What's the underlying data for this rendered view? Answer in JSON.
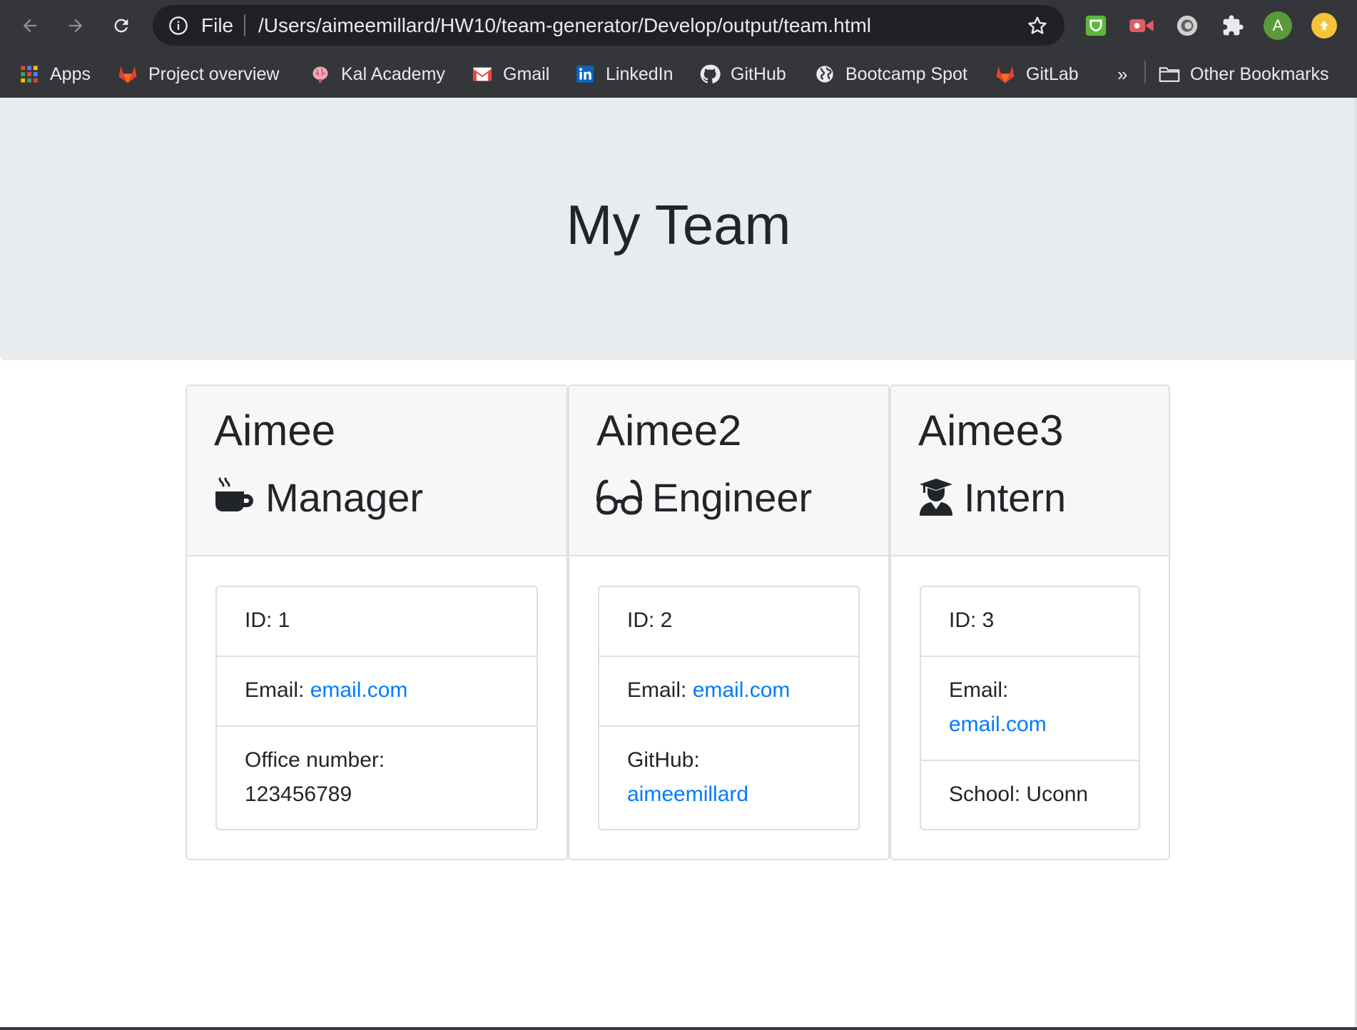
{
  "browser": {
    "scheme_label": "File",
    "url": "/Users/aimeemillard/HW10/team-generator/Develop/output/team.html",
    "avatar_letter": "A",
    "bookmarks": [
      {
        "label": "Apps",
        "icon": "apps-grid-icon"
      },
      {
        "label": "Project overview",
        "icon": "gitlab-icon"
      },
      {
        "label": "Kal Academy",
        "icon": "brain-icon"
      },
      {
        "label": "Gmail",
        "icon": "gmail-icon"
      },
      {
        "label": "LinkedIn",
        "icon": "linkedin-icon"
      },
      {
        "label": "GitHub",
        "icon": "github-icon"
      },
      {
        "label": "Bootcamp Spot",
        "icon": "globe-icon"
      },
      {
        "label": "GitLab",
        "icon": "gitlab-icon"
      }
    ],
    "overflow_label": "»",
    "other_bookmarks_label": "Other Bookmarks"
  },
  "page": {
    "title": "My Team",
    "cards": [
      {
        "name": "Aimee",
        "role": "Manager",
        "role_icon": "coffee-icon",
        "id_text": "ID: 1",
        "email_label": "Email: ",
        "email_link": "email.com",
        "extra_label": "Office number:",
        "extra_value": "123456789"
      },
      {
        "name": "Aimee2",
        "role": "Engineer",
        "role_icon": "glasses-icon",
        "id_text": "ID: 2",
        "email_label": "Email: ",
        "email_link": "email.com",
        "extra_label": "GitHub:",
        "extra_link": "aimeemillard"
      },
      {
        "name": "Aimee3",
        "role": "Intern",
        "role_icon": "graduate-icon",
        "id_text": "ID: 3",
        "email_label": "Email:",
        "email_link": "email.com",
        "extra_text": "School: Uconn"
      }
    ]
  },
  "colors": {
    "chrome_bg": "#35363a",
    "jumbotron_bg": "#e9ecef",
    "link": "#007bff",
    "text": "#212529"
  }
}
